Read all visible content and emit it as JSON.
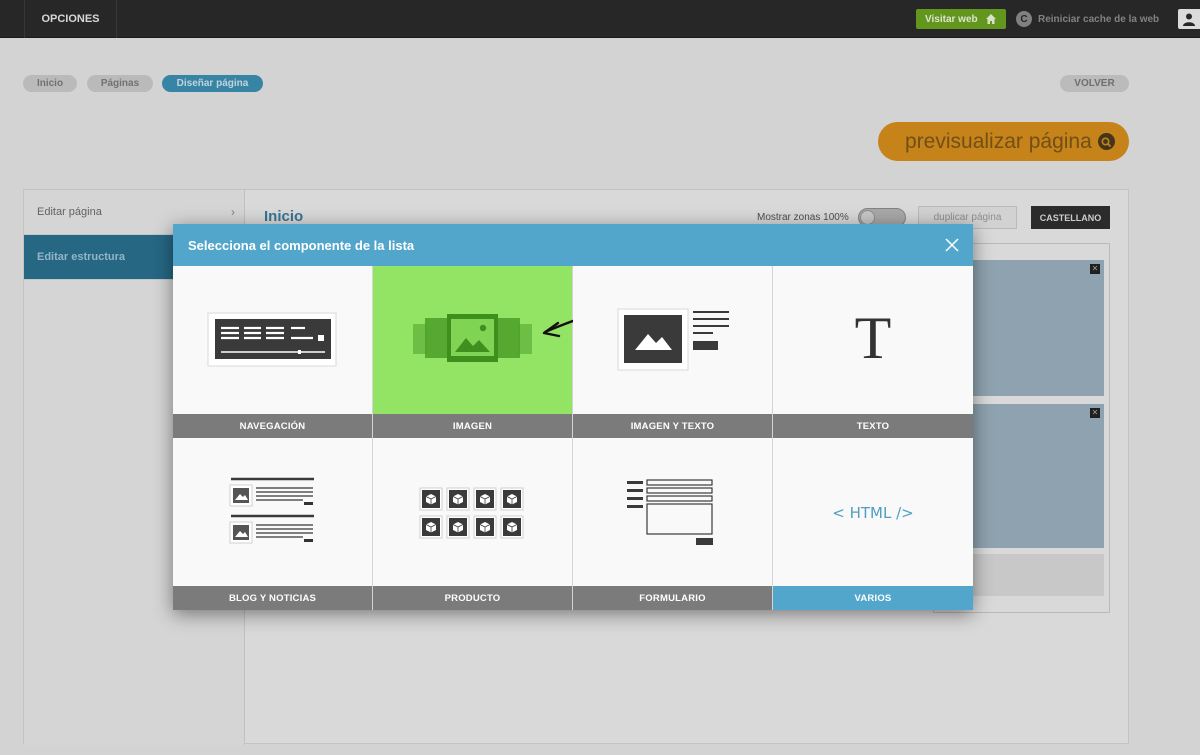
{
  "topbar": {
    "opciones_label": "OPCIONES",
    "visit_label": "Visitar web",
    "reset_label": "Reiniciar cache de la web",
    "reset_icon_glyph": "C"
  },
  "breadcrumb": {
    "items": [
      "Inicio",
      "Páginas",
      "Diseñar página"
    ],
    "back_label": "VOLVER"
  },
  "preview_label": "previsualizar página",
  "sidebar": {
    "items": [
      {
        "label": "Editar página"
      },
      {
        "label": "Editar estructura"
      }
    ]
  },
  "content": {
    "title": "Inicio",
    "zones_label": "Mostrar zonas 100%",
    "duplicate_label": "duplicar página",
    "language_label": "CASTELLANO",
    "zone_close_glyph": "✕"
  },
  "modal": {
    "title": "Selecciona el componente de la lista",
    "components": [
      {
        "label": "NAVEGACIÓN",
        "icon": "navigation-icon"
      },
      {
        "label": "IMAGEN",
        "icon": "image-slider-icon"
      },
      {
        "label": "IMAGEN Y TEXTO",
        "icon": "image-text-icon"
      },
      {
        "label": "TEXTO",
        "icon": "text-icon",
        "glyph": "T"
      },
      {
        "label": "BLOG Y NOTICIAS",
        "icon": "blog-icon"
      },
      {
        "label": "PRODUCTO",
        "icon": "product-icon"
      },
      {
        "label": "FORMULARIO",
        "icon": "form-icon"
      },
      {
        "label": "VARIOS",
        "icon": "html-icon",
        "code": "< HTML />"
      }
    ],
    "selected": "IMAGEN",
    "highlighted": "VARIOS"
  },
  "colors": {
    "accent_blue": "#52a6cb",
    "selected_green": "#93e364",
    "visit_green": "#6aa220",
    "preview_orange": "#d68d1c",
    "topbar_dark": "#2b2b2b"
  }
}
